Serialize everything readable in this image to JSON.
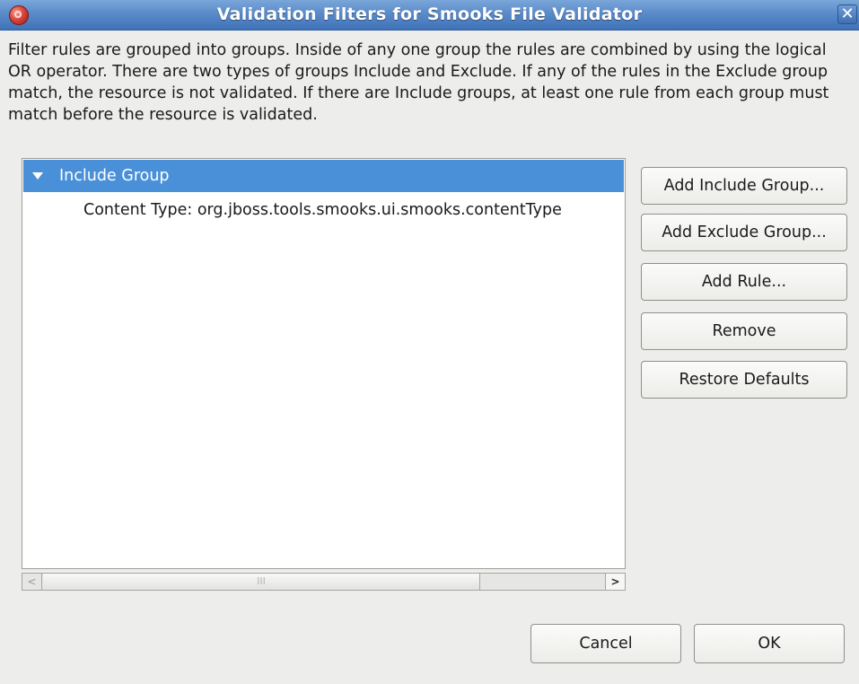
{
  "window": {
    "title": "Validation Filters for Smooks File Validator",
    "close_glyph": "✕"
  },
  "description": "Filter rules are grouped into groups. Inside of any one group the rules are combined by using the logical OR operator. There are two types of groups Include and Exclude. If any of the rules in the Exclude group match, the resource is not validated. If there are Include groups, at least one rule from each group must match before the resource is validated.",
  "tree": {
    "group_label": "Include Group",
    "rule_label": "Content Type: org.jboss.tools.smooks.ui.smooks.contentType"
  },
  "scrollbar": {
    "left_arrow": "<",
    "right_arrow": ">",
    "thumb_grip": "III"
  },
  "side_buttons": {
    "add_include_group": "Add Include Group...",
    "add_exclude_group": "Add Exclude Group...",
    "add_rule": "Add Rule...",
    "remove": "Remove",
    "restore_defaults": "Restore Defaults"
  },
  "footer": {
    "cancel": "Cancel",
    "ok": "OK"
  },
  "colors": {
    "title_bar": "#4f82c4",
    "selection": "#4a90d9",
    "dialog_bg": "#ededeb"
  }
}
